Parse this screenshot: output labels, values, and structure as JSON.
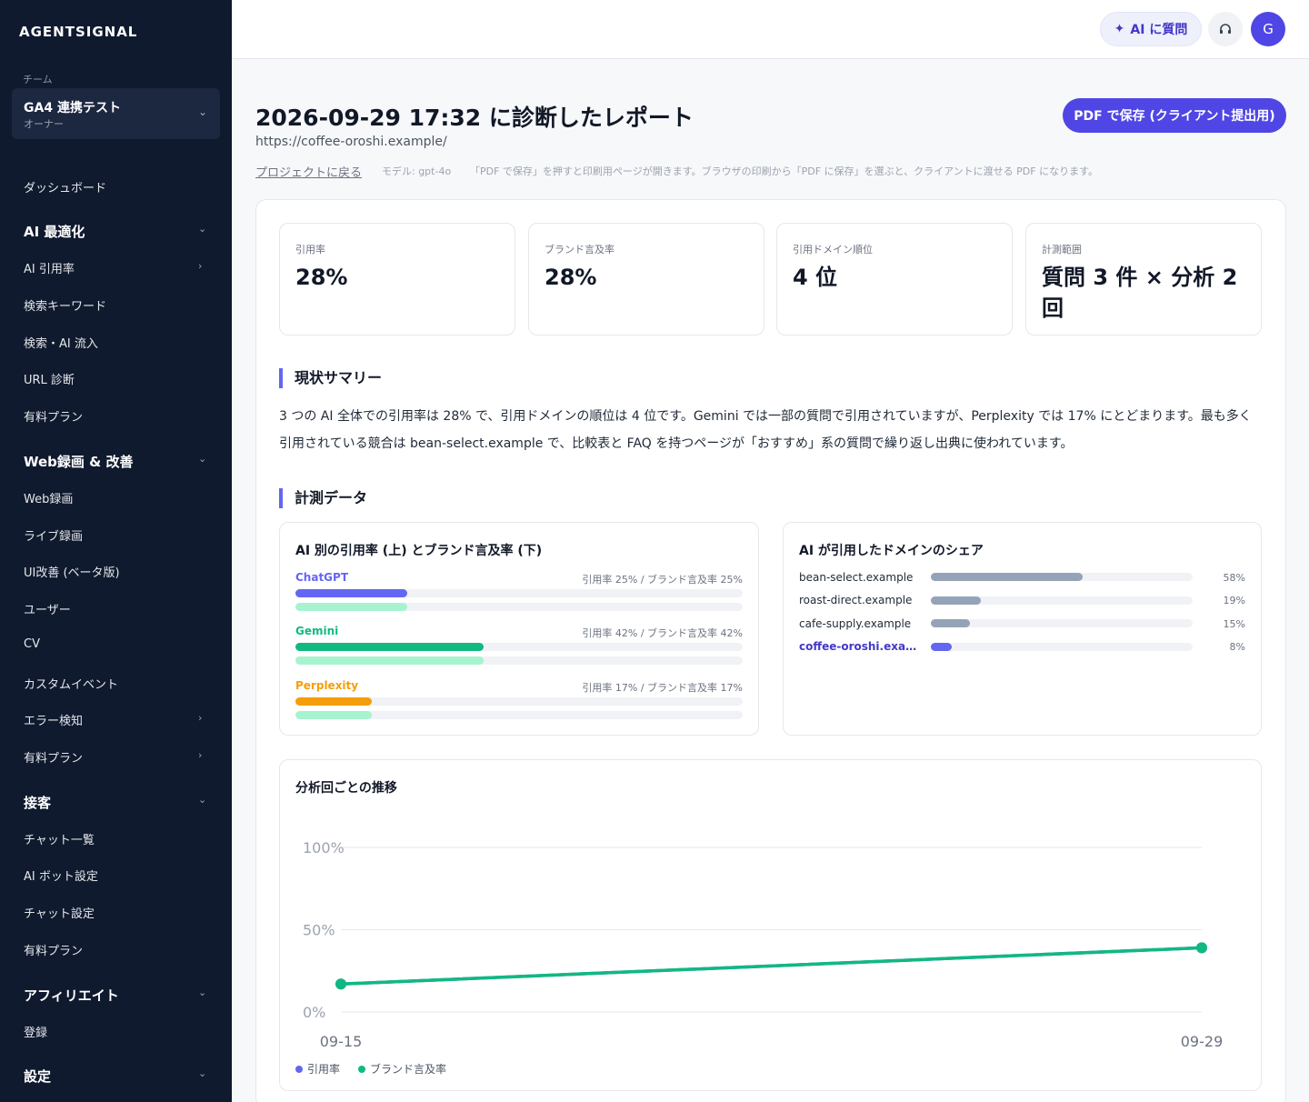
{
  "sidebar": {
    "brand": "AGENTSIGNAL",
    "team_label": "チーム",
    "team_name": "GA4 連携テスト",
    "team_role": "オーナー",
    "dashboard": "ダッシュボード",
    "sections": [
      {
        "title": "AI 最適化",
        "items": [
          "AI 引用率",
          "検索キーワード",
          "検索・AI 流入",
          "URL 診断",
          "有料プラン"
        ]
      },
      {
        "title": "Web録画 & 改善",
        "items": [
          "Web録画",
          "ライブ録画",
          "UI改善 (ベータ版)",
          "ユーザー",
          "CV",
          "カスタムイベント",
          "エラー検知",
          "有料プラン"
        ]
      },
      {
        "title": "接客",
        "items": [
          "チャット一覧",
          "AI ボット設定",
          "チャット設定",
          "有料プラン"
        ]
      },
      {
        "title": "アフィリエイト",
        "items": [
          "登録"
        ]
      },
      {
        "title": "設定",
        "items": []
      }
    ]
  },
  "topbar": {
    "ai_ask_label": "AI に質問",
    "avatar_initial": "G"
  },
  "header": {
    "title": "2026-09-29 17:32 に診断したレポート",
    "url": "https://coffee-oroshi.example/",
    "back_label": "プロジェクトに戻る",
    "model": "モデル: gpt-4o",
    "hint": "「PDF で保存」を押すと印刷用ページが開きます。ブラウザの印刷から「PDF に保存」を選ぶと、クライアントに渡せる PDF になります。",
    "pdf_button": "PDF で保存 (クライアント提出用)"
  },
  "kpis": [
    {
      "label": "引用率",
      "value": "28%"
    },
    {
      "label": "ブランド言及率",
      "value": "28%"
    },
    {
      "label": "引用ドメイン順位",
      "value": "4 位"
    },
    {
      "label": "計測範囲",
      "value": "質問 3 件 × 分析 2 回"
    }
  ],
  "summary": {
    "heading": "現状サマリー",
    "text": "3 つの AI 全体での引用率は 28% で、引用ドメインの順位は 4 位です。Gemini では一部の質問で引用されていますが、Perplexity では 17% にとどまります。最も多く引用されている競合は bean-select.example で、比較表と FAQ を持つページが「おすすめ」系の質問で繰り返し出典に使われています。"
  },
  "measure": {
    "heading": "計測データ",
    "ai_panel": {
      "title": "AI 別の引用率 (上) とブランド言及率 (下)",
      "rows": [
        {
          "name": "ChatGPT",
          "color": "#6366f1",
          "citation": 25,
          "mention": 25,
          "stat": "引用率 25% / ブランド言及率 25%"
        },
        {
          "name": "Gemini",
          "color": "#10b981",
          "citation": 42,
          "mention": 42,
          "stat": "引用率 42% / ブランド言及率 42%"
        },
        {
          "name": "Perplexity",
          "color": "#f59e0b",
          "citation": 17,
          "mention": 17,
          "stat": "引用率 17% / ブランド言及率 17%"
        }
      ],
      "mention_color": "#a7f3d0"
    },
    "domain_panel": {
      "title": "AI が引用したドメインのシェア",
      "rows": [
        {
          "name": "bean-select.example",
          "share": 58,
          "label": "58%",
          "own": false
        },
        {
          "name": "roast-direct.example",
          "share": 19,
          "label": "19%",
          "own": false
        },
        {
          "name": "cafe-supply.example",
          "share": 15,
          "label": "15%",
          "own": false
        },
        {
          "name": "coffee-oroshi.example",
          "share": 8,
          "label": "8%",
          "own": true
        }
      ],
      "bar_color": "#94a3b8",
      "own_color": "#6366f1"
    }
  },
  "trend": {
    "title": "分析回ごとの推移",
    "legend": [
      {
        "label": "引用率",
        "color": "#6366f1"
      },
      {
        "label": "ブランド言及率",
        "color": "#10b981"
      }
    ]
  },
  "chart_data": {
    "type": "line",
    "title": "分析回ごとの推移",
    "x": [
      "09-15",
      "09-29"
    ],
    "yticks": [
      "0%",
      "50%",
      "100%"
    ],
    "ylim": [
      0,
      100
    ],
    "grid": true,
    "legend_position": "bottom-left",
    "series": [
      {
        "name": "引用率",
        "color": "#6366f1",
        "values": [
          17,
          39
        ]
      },
      {
        "name": "ブランド言及率",
        "color": "#10b981",
        "values": [
          17,
          39
        ]
      }
    ]
  }
}
